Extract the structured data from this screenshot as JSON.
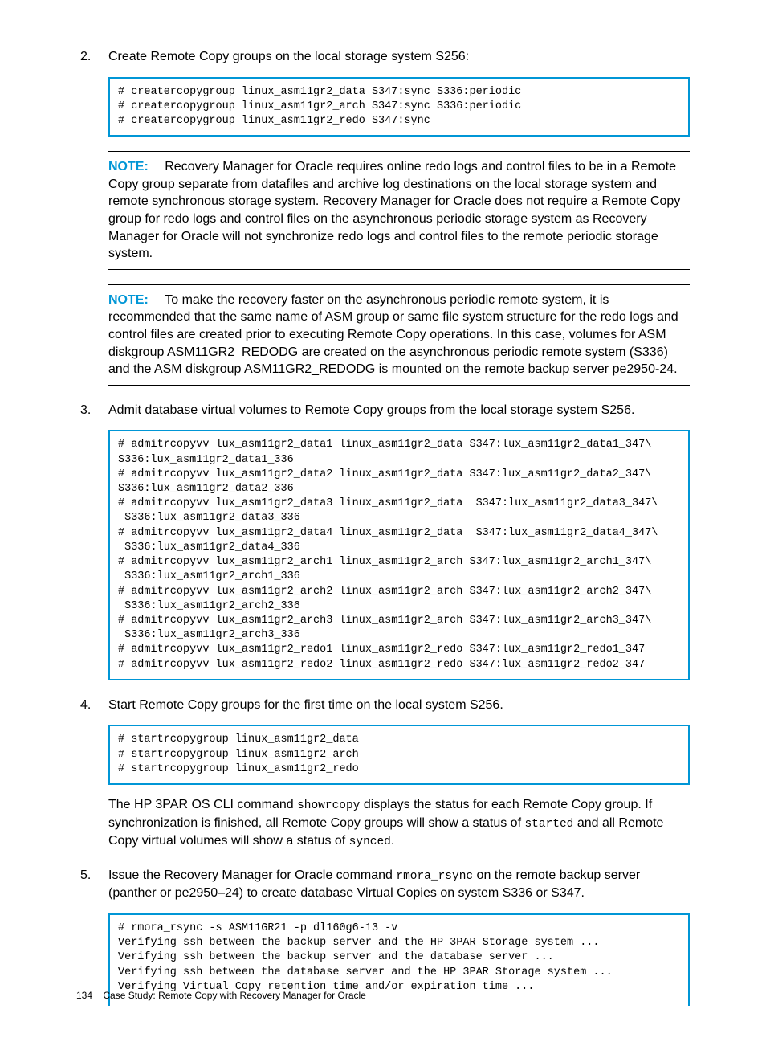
{
  "steps": {
    "s2": {
      "text": "Create Remote Copy groups on the local storage system S256:",
      "code": "# creatercopygroup linux_asm11gr2_data S347:sync S336:periodic\n# creatercopygroup linux_asm11gr2_arch S347:sync S336:periodic\n# creatercopygroup linux_asm11gr2_redo S347:sync",
      "note1_label": "NOTE:",
      "note1_text": "Recovery Manager for Oracle requires online redo logs and control files to be in a Remote Copy group separate from datafiles and archive log destinations on the local storage system and remote synchronous storage system. Recovery Manager for Oracle does not require a Remote Copy group for redo logs and control files on the asynchronous periodic storage system as Recovery Manager for Oracle will not synchronize redo logs and control files to the remote periodic storage system.",
      "note2_label": "NOTE:",
      "note2_text": "To make the recovery faster on the asynchronous periodic remote system, it is recommended that the same name of ASM group or same file system structure for the redo logs and control files are created prior to executing Remote Copy operations. In this case, volumes for ASM diskgroup ASM11GR2_REDODG are created on the asynchronous periodic remote system (S336) and the ASM diskgroup ASM11GR2_REDODG is mounted on the remote backup server pe2950-24."
    },
    "s3": {
      "text": "Admit database virtual volumes to Remote Copy groups from the local storage system S256.",
      "code": "# admitrcopyvv lux_asm11gr2_data1 linux_asm11gr2_data S347:lux_asm11gr2_data1_347\\\nS336:lux_asm11gr2_data1_336\n# admitrcopyvv lux_asm11gr2_data2 linux_asm11gr2_data S347:lux_asm11gr2_data2_347\\\nS336:lux_asm11gr2_data2_336\n# admitrcopyvv lux_asm11gr2_data3 linux_asm11gr2_data  S347:lux_asm11gr2_data3_347\\\n S336:lux_asm11gr2_data3_336\n# admitrcopyvv lux_asm11gr2_data4 linux_asm11gr2_data  S347:lux_asm11gr2_data4_347\\\n S336:lux_asm11gr2_data4_336\n# admitrcopyvv lux_asm11gr2_arch1 linux_asm11gr2_arch S347:lux_asm11gr2_arch1_347\\\n S336:lux_asm11gr2_arch1_336\n# admitrcopyvv lux_asm11gr2_arch2 linux_asm11gr2_arch S347:lux_asm11gr2_arch2_347\\\n S336:lux_asm11gr2_arch2_336\n# admitrcopyvv lux_asm11gr2_arch3 linux_asm11gr2_arch S347:lux_asm11gr2_arch3_347\\\n S336:lux_asm11gr2_arch3_336\n# admitrcopyvv lux_asm11gr2_redo1 linux_asm11gr2_redo S347:lux_asm11gr2_redo1_347\n# admitrcopyvv lux_asm11gr2_redo2 linux_asm11gr2_redo S347:lux_asm11gr2_redo2_347"
    },
    "s4": {
      "text": "Start Remote Copy groups for the first time on the local system S256.",
      "code": "# startrcopygroup linux_asm11gr2_data\n# startrcopygroup linux_asm11gr2_arch\n# startrcopygroup linux_asm11gr2_redo",
      "post_a": "The HP 3PAR OS CLI command ",
      "post_code1": "showrcopy",
      "post_b": " displays the status for each Remote Copy group. If synchronization is finished, all Remote Copy groups will show a status of ",
      "post_code2": "started",
      "post_c": " and all Remote Copy virtual volumes will show a status of ",
      "post_code3": "synced",
      "post_d": "."
    },
    "s5": {
      "text_a": "Issue the Recovery Manager for Oracle command ",
      "text_code": "rmora_rsync",
      "text_b": " on the remote backup server (panther or pe2950–24) to create database Virtual Copies on system S336 or S347.",
      "code": "# rmora_rsync -s ASM11GR21 -p dl160g6-13 -v\nVerifying ssh between the backup server and the HP 3PAR Storage system ...\nVerifying ssh between the backup server and the database server ...\nVerifying ssh between the database server and the HP 3PAR Storage system ...\nVerifying Virtual Copy retention time and/or expiration time ..."
    }
  },
  "footer": {
    "page": "134",
    "title": "Case Study: Remote Copy with Recovery Manager for Oracle"
  }
}
